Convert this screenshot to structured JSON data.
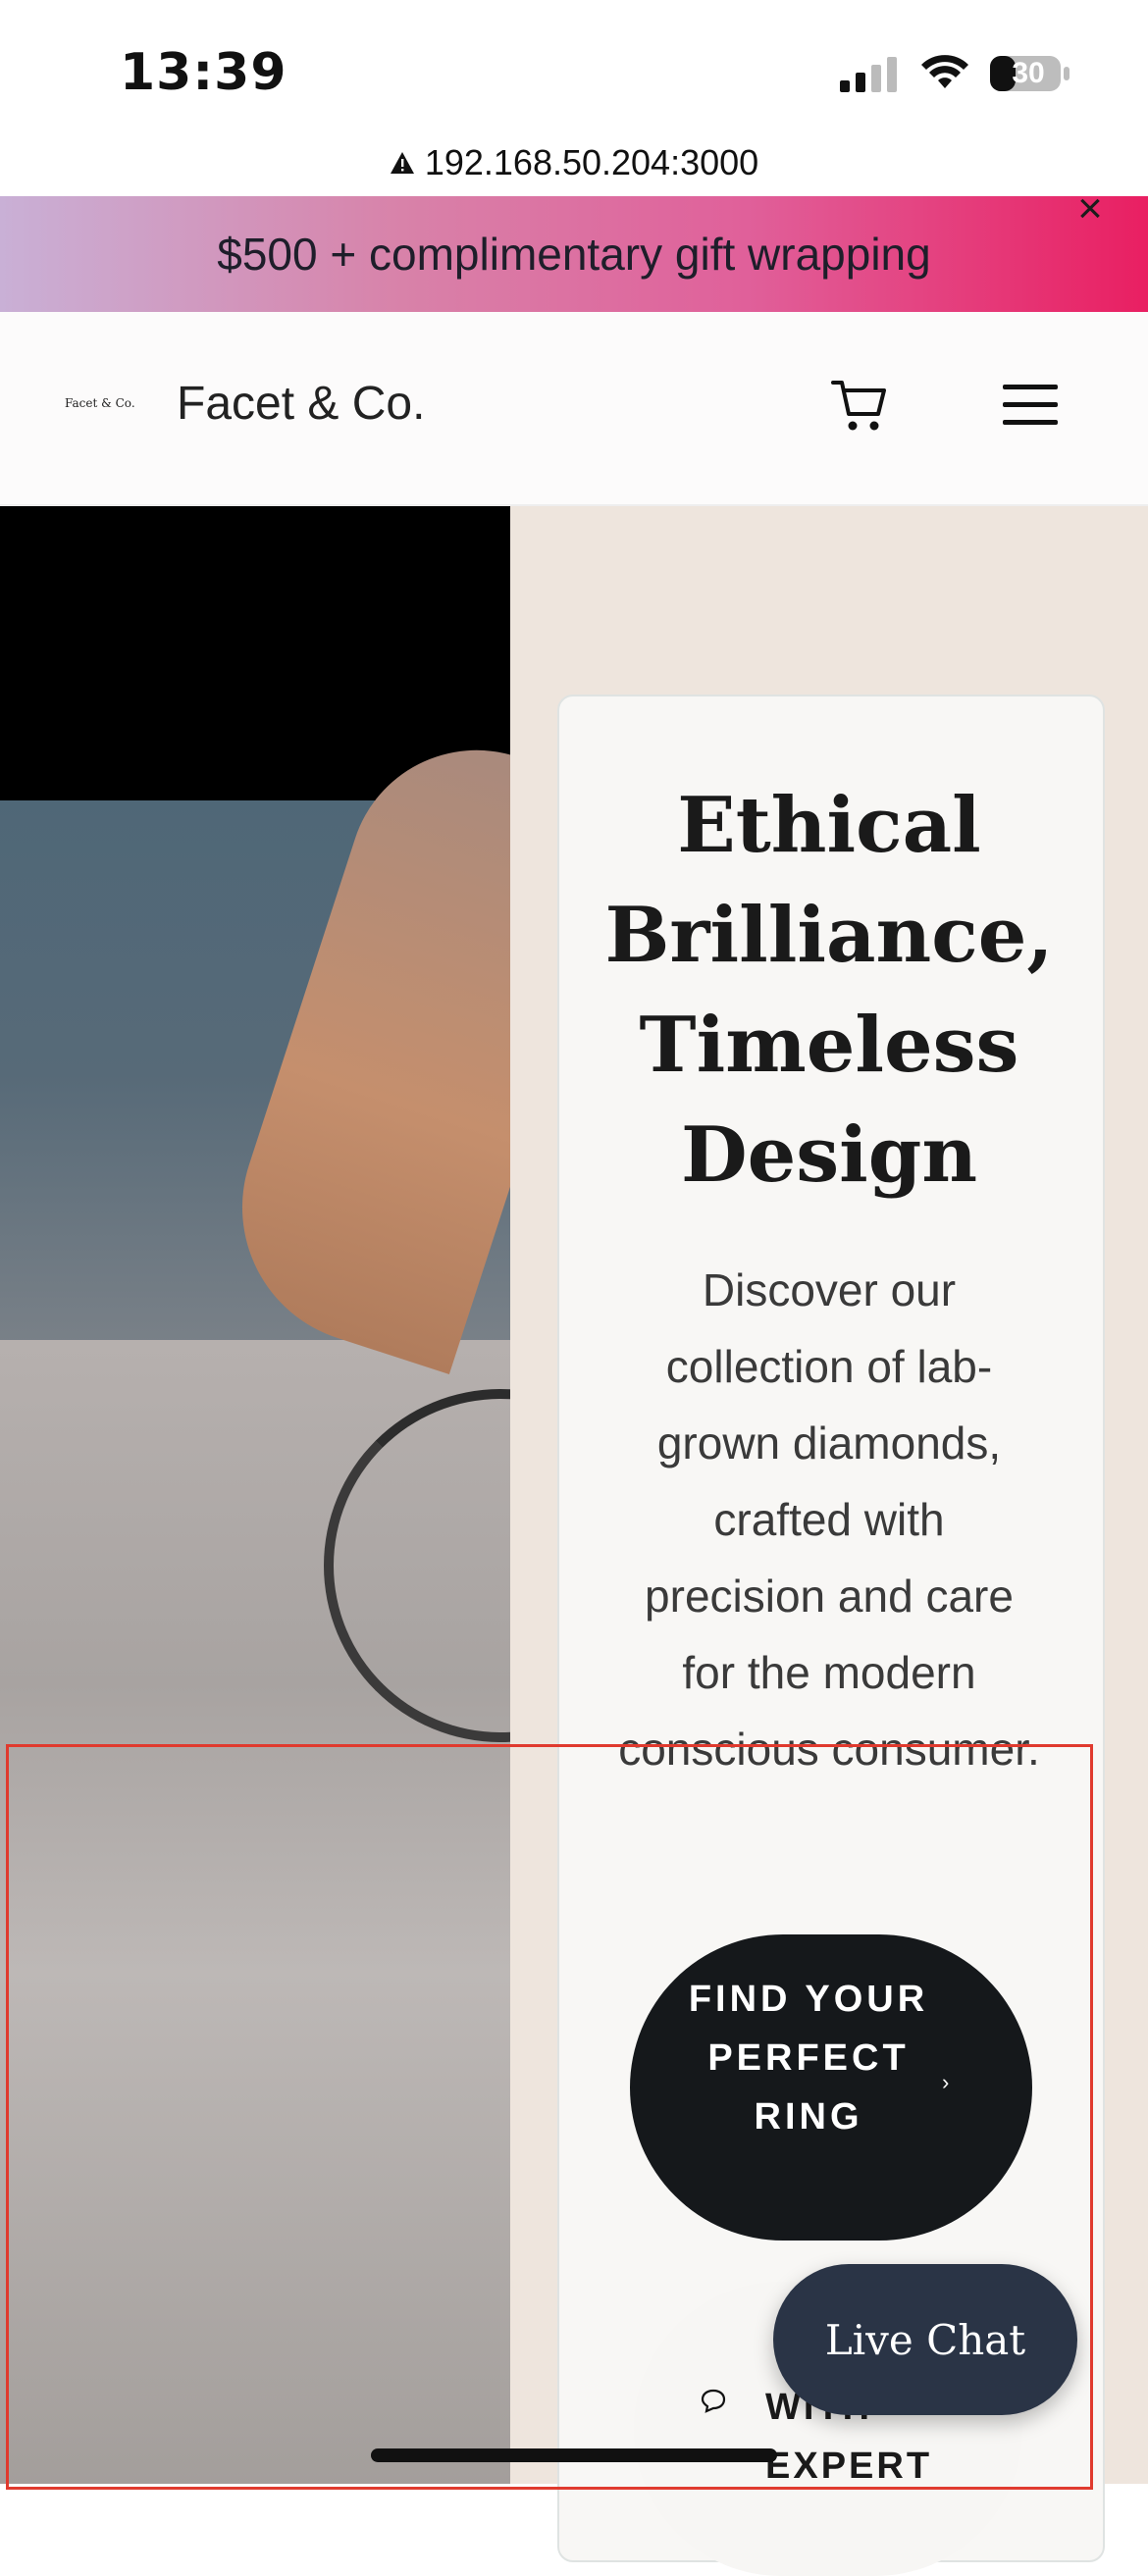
{
  "status_bar": {
    "time": "13:39",
    "battery": "30",
    "icons": [
      "signal-icon",
      "wifi-icon",
      "battery-icon"
    ]
  },
  "browser": {
    "url": "192.168.50.204:3000",
    "security_icon": "warning-icon"
  },
  "promo": {
    "text": "$500 + complimentary gift wrapping",
    "close_label": "×"
  },
  "header": {
    "logo_mark": "Facet & Co.",
    "brand": "Facet & Co.",
    "cart_icon": "cart-icon",
    "menu_icon": "hamburger-menu-icon"
  },
  "hero": {
    "title": "Ethical Brilliance, Timeless Design",
    "body": "Discover our collection of lab-grown diamonds, crafted with precision and care for the modern conscious consumer.",
    "cta_primary": "FIND YOUR PERFECT RING",
    "cta_secondary": "WITH EXPERT"
  },
  "chat": {
    "label": "Live Chat"
  },
  "colors": {
    "banner_start": "#c9b0d6",
    "banner_end": "#e91f62",
    "cta_bg": "#15181b",
    "live_chat_bg": "#2a3446",
    "hero_bg": "#eee5dd",
    "highlight": "#e03a2e"
  }
}
